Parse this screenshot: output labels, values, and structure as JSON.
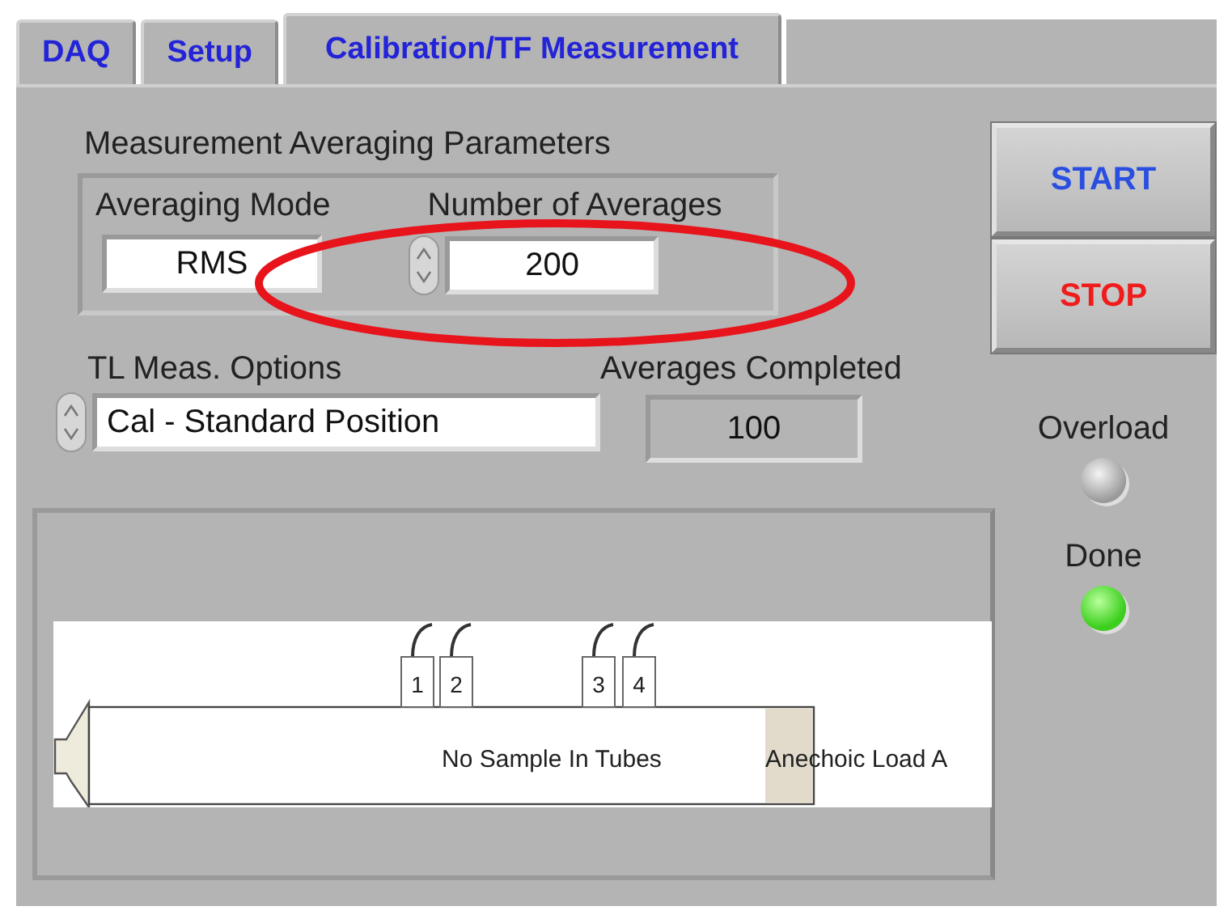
{
  "tabs": [
    {
      "label": "DAQ",
      "selected": false
    },
    {
      "label": "Setup",
      "selected": false
    },
    {
      "label": "Calibration/TF Measurement",
      "selected": true
    }
  ],
  "averaging": {
    "title": "Measurement Averaging Parameters",
    "mode_label": "Averaging Mode",
    "mode_value": "RMS",
    "count_label": "Number of Averages",
    "count_value": "200"
  },
  "tl_options": {
    "label": "TL Meas. Options",
    "value": "Cal - Standard Position"
  },
  "completed": {
    "label": "Averages Completed",
    "value": "100"
  },
  "buttons": [
    {
      "label": "START",
      "kind": "start"
    },
    {
      "label": "STOP",
      "kind": "stop"
    }
  ],
  "indicators": [
    {
      "label": "Overload",
      "on": false
    },
    {
      "label": "Done",
      "on": true
    }
  ],
  "diagram": {
    "sensors": [
      "1",
      "2",
      "3",
      "4"
    ],
    "tube_label": "No Sample In Tubes",
    "load_label": "Anechoic Load A"
  }
}
